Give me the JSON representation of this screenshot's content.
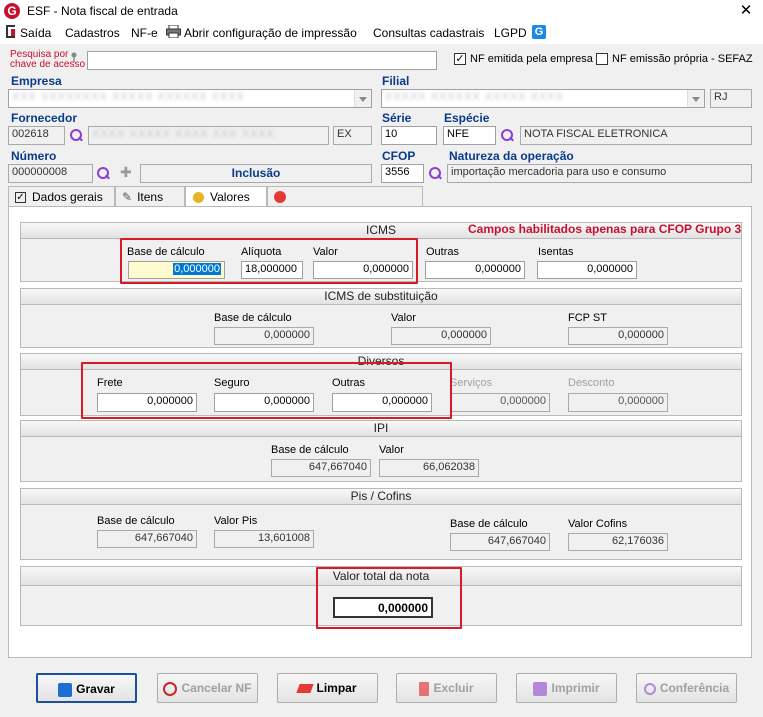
{
  "window": {
    "title": "ESF - Nota fiscal de entrada",
    "app_logo": "G",
    "close": "✕"
  },
  "menu": {
    "items": [
      "Saída",
      "Cadastros",
      "NF-e",
      "Abrir configuração de impressão",
      "Consultas cadastrais",
      "LGPD"
    ]
  },
  "search": {
    "label_line1": "Pesquisa por",
    "label_line2": "chave de acesso",
    "value": ""
  },
  "flags": {
    "nf_emitida_empresa": {
      "label": "NF emitida pela empresa",
      "checked": true
    },
    "nf_emissao_propria": {
      "label": "NF emissão própria - SEFAZ",
      "checked": false
    }
  },
  "empresa": {
    "label": "Empresa",
    "value": "XXX XXXXXXXX XXXXX XXXXXX XXXX"
  },
  "filial": {
    "label": "Filial",
    "value": "XXXXX XXXXXX XXXXX XXXX",
    "uf": "RJ"
  },
  "fornecedor": {
    "label": "Fornecedor",
    "code": "002618",
    "name": "XXXX XXXXX XXXX XXX XXXX",
    "uf": "EX"
  },
  "serie": {
    "label": "Série",
    "value": "10"
  },
  "especie": {
    "label": "Espécie",
    "code": "NFE",
    "desc": "NOTA FISCAL ELETRONICA"
  },
  "numero": {
    "label": "Número",
    "value": "000000008",
    "status": "Inclusão"
  },
  "cfop": {
    "label": "CFOP",
    "value": "3556"
  },
  "natureza": {
    "label": "Natureza da operação",
    "value": "importação mercadoria para uso e consumo"
  },
  "tabs": [
    "Dados gerais",
    "Itens",
    "Valores"
  ],
  "icms": {
    "title": "ICMS",
    "note": "Campos habilitados apenas para CFOP Grupo 3",
    "base_label": "Base de cálculo",
    "base_value": "0,000000",
    "aliquota_label": "Alíquota",
    "aliquota_value": "18,000000",
    "valor_label": "Valor",
    "valor_value": "0,000000",
    "outras_label": "Outras",
    "outras_value": "0,000000",
    "isentas_label": "Isentas",
    "isentas_value": "0,000000"
  },
  "icms_st": {
    "title": "ICMS de substituição",
    "base_label": "Base de cálculo",
    "base_value": "0,000000",
    "valor_label": "Valor",
    "valor_value": "0,000000",
    "fcp_label": "FCP ST",
    "fcp_value": "0,000000"
  },
  "diversos": {
    "title": "Diversos",
    "frete_label": "Frete",
    "frete_value": "0,000000",
    "seguro_label": "Seguro",
    "seguro_value": "0,000000",
    "outras_label": "Outras",
    "outras_value": "0,000000",
    "servicos_label": "Serviços",
    "servicos_value": "0,000000",
    "desconto_label": "Desconto",
    "desconto_value": "0,000000"
  },
  "ipi": {
    "title": "IPI",
    "base_label": "Base de cálculo",
    "base_value": "647,667040",
    "valor_label": "Valor",
    "valor_value": "66,062038"
  },
  "pis_cofins": {
    "title": "Pis / Cofins",
    "pis_base_label": "Base de cálculo",
    "pis_base_value": "647,667040",
    "pis_valor_label": "Valor Pis",
    "pis_valor_value": "13,601008",
    "cofins_base_label": "Base de cálculo",
    "cofins_base_value": "647,667040",
    "cofins_valor_label": "Valor Cofins",
    "cofins_valor_value": "62,176036"
  },
  "total": {
    "title": "Valor total da nota",
    "value": "0,000000"
  },
  "buttons": {
    "gravar": "Gravar",
    "cancelar": "Cancelar NF",
    "limpar": "Limpar",
    "excluir": "Excluir",
    "imprimir": "Imprimir",
    "conferencia": "Conferência"
  },
  "colors": {
    "brand": "#c8102e",
    "link_purple": "#8b3fd1",
    "label_blue": "#0a3a8a",
    "highlight_box": "#d81b27",
    "selection": "#0078d7"
  }
}
